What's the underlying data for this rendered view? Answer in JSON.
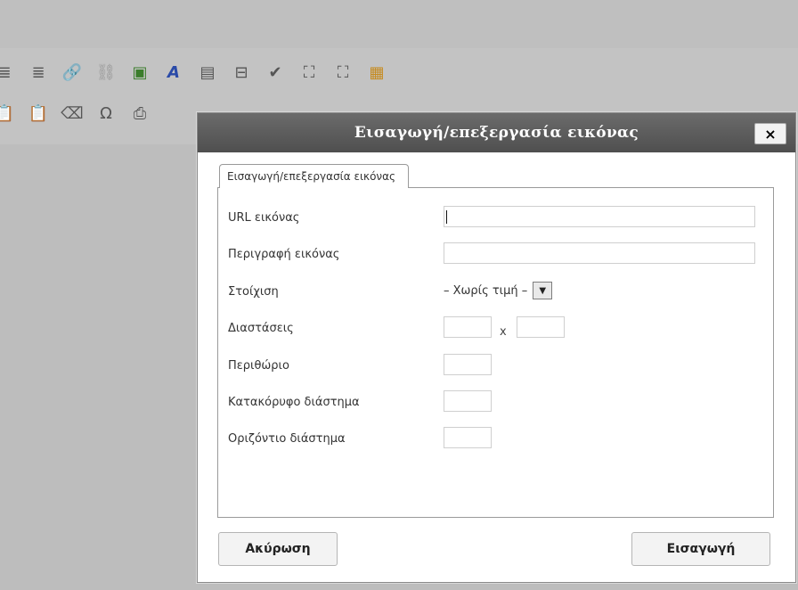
{
  "toolbar": {
    "row1": [
      {
        "name": "align-center-icon",
        "glyph": "≣",
        "style": ""
      },
      {
        "name": "align-justify-icon",
        "glyph": "≣",
        "style": ""
      },
      {
        "name": "link-icon",
        "glyph": "🔗",
        "style": "faded"
      },
      {
        "name": "unlink-icon",
        "glyph": "⛓",
        "style": "faded"
      },
      {
        "name": "image-icon",
        "glyph": "▣",
        "style": "green"
      },
      {
        "name": "text-format-icon",
        "glyph": "A",
        "style": "blue"
      },
      {
        "name": "horizontal-rule-icon",
        "glyph": "▤",
        "style": ""
      },
      {
        "name": "page-break-icon",
        "glyph": "⊟",
        "style": ""
      },
      {
        "name": "spellcheck-icon",
        "glyph": "✔",
        "style": ""
      },
      {
        "name": "find-icon",
        "glyph": "⛶",
        "style": ""
      },
      {
        "name": "fullscreen-icon",
        "glyph": "⛶",
        "style": ""
      },
      {
        "name": "media-icon",
        "glyph": "▦",
        "style": "gold"
      }
    ],
    "row2": [
      {
        "name": "paste-text-icon",
        "glyph": "📋",
        "style": ""
      },
      {
        "name": "paste-word-icon",
        "glyph": "📋",
        "style": ""
      },
      {
        "name": "eraser-icon",
        "glyph": "⌫",
        "style": ""
      },
      {
        "name": "omega-icon",
        "glyph": "Ω",
        "style": ""
      },
      {
        "name": "print-icon",
        "glyph": "⎙",
        "style": ""
      }
    ]
  },
  "dialog": {
    "title": "Εισαγωγή/επεξεργασία εικόνας",
    "close_label": "×",
    "tab_label": "Εισαγωγή/επεξεργασία εικόνας",
    "fields": {
      "url_label": "URL εικόνας",
      "url_value": "",
      "description_label": "Περιγραφή εικόνας",
      "description_value": "",
      "alignment_label": "Στοίχιση",
      "alignment_selected": "– Χωρίς τιμή –",
      "dimensions_label": "Διαστάσεις",
      "dimensions_width": "",
      "dimensions_separator": "x",
      "dimensions_height": "",
      "margin_label": "Περιθώριο",
      "margin_value": "",
      "vspace_label": "Κατακόρυφο διάστημα",
      "vspace_value": "",
      "hspace_label": "Οριζόντιο διάστημα",
      "hspace_value": ""
    },
    "buttons": {
      "cancel": "Ακύρωση",
      "insert": "Εισαγωγή"
    }
  }
}
